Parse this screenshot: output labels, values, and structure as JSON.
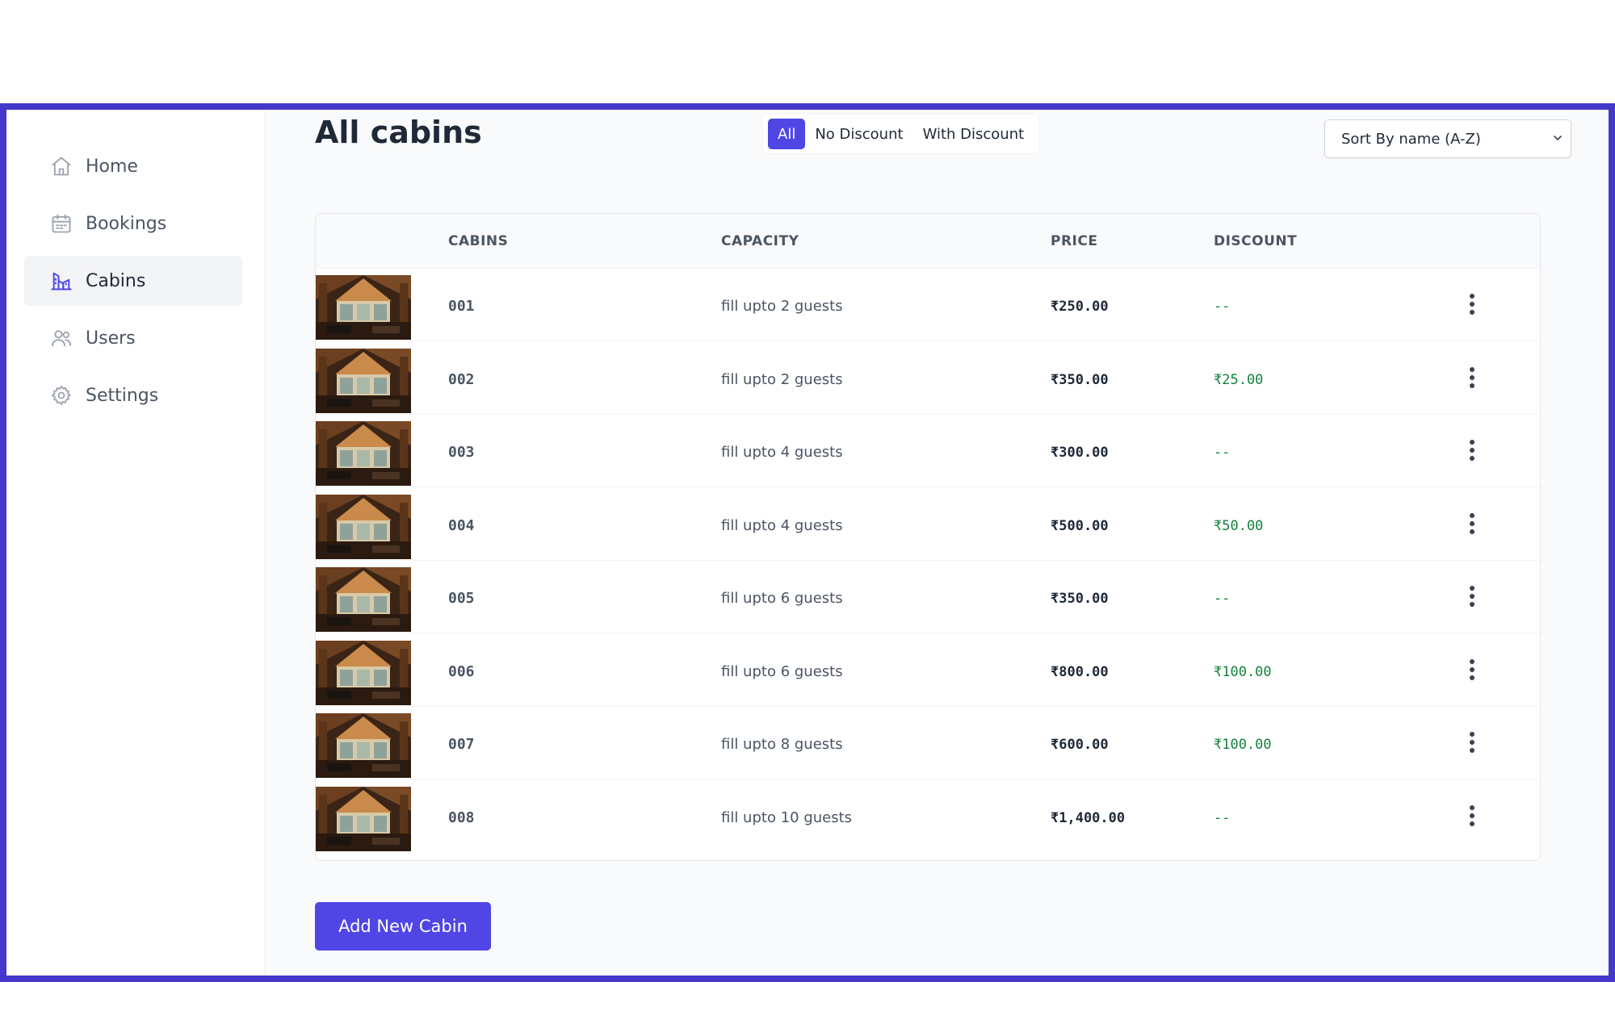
{
  "sidebar": {
    "items": [
      {
        "label": "Home",
        "icon": "home-icon",
        "active": false
      },
      {
        "label": "Bookings",
        "icon": "calendar-icon",
        "active": false
      },
      {
        "label": "Cabins",
        "icon": "cabins-icon",
        "active": true
      },
      {
        "label": "Users",
        "icon": "users-icon",
        "active": false
      },
      {
        "label": "Settings",
        "icon": "gear-icon",
        "active": false
      }
    ]
  },
  "header": {
    "title": "All cabins",
    "filters": [
      "All",
      "No Discount",
      "With Discount"
    ],
    "active_filter": "All",
    "sort_selected": "Sort By name (A-Z)"
  },
  "table": {
    "columns": [
      "CABINS",
      "CAPACITY",
      "PRICE",
      "DISCOUNT"
    ],
    "rows": [
      {
        "name": "001",
        "capacity": "fill upto 2 guests",
        "price": "₹250.00",
        "discount": "--"
      },
      {
        "name": "002",
        "capacity": "fill upto 2 guests",
        "price": "₹350.00",
        "discount": "₹25.00"
      },
      {
        "name": "003",
        "capacity": "fill upto 4 guests",
        "price": "₹300.00",
        "discount": "--"
      },
      {
        "name": "004",
        "capacity": "fill upto 4 guests",
        "price": "₹500.00",
        "discount": "₹50.00"
      },
      {
        "name": "005",
        "capacity": "fill upto 6 guests",
        "price": "₹350.00",
        "discount": "--"
      },
      {
        "name": "006",
        "capacity": "fill upto 6 guests",
        "price": "₹800.00",
        "discount": "₹100.00"
      },
      {
        "name": "007",
        "capacity": "fill upto 8 guests",
        "price": "₹600.00",
        "discount": "₹100.00"
      },
      {
        "name": "008",
        "capacity": "fill upto 10 guests",
        "price": "₹1,400.00",
        "discount": "--"
      }
    ]
  },
  "actions": {
    "add_label": "Add New Cabin"
  },
  "colors": {
    "accent": "#4f46e5",
    "frame": "#4338ca",
    "discount": "#15803d"
  }
}
